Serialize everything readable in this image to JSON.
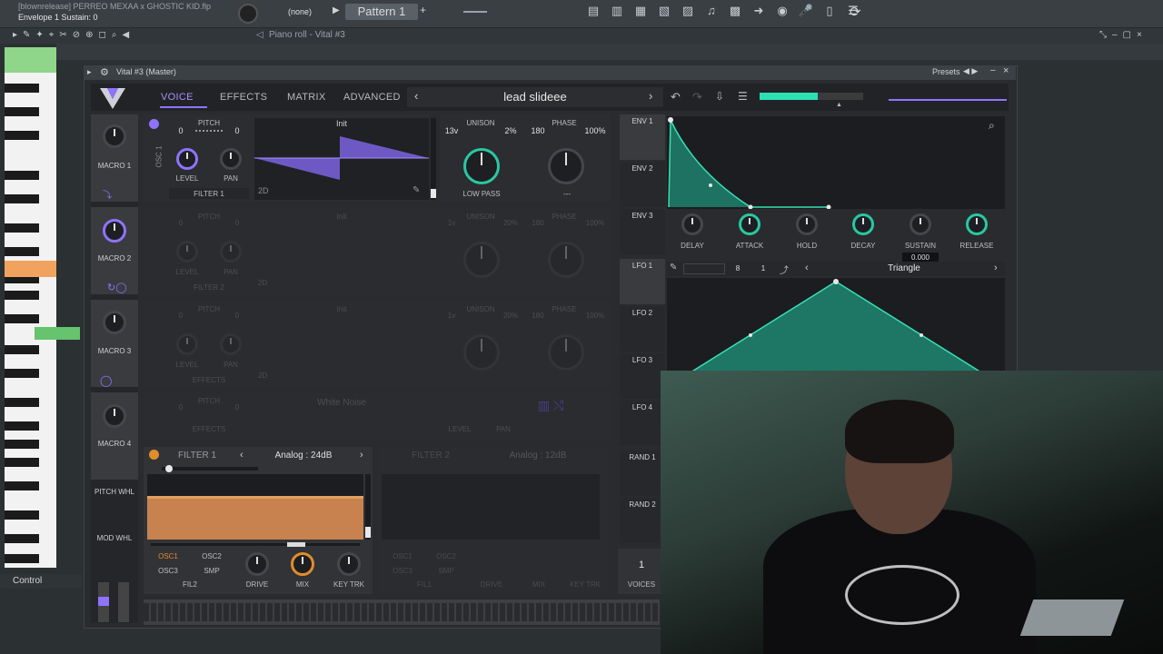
{
  "fl": {
    "file_title": "[blownrelease] PERREO MEXAA x GHOSTIC KID.flp",
    "hint": "Envelope 1 Sustain: 0",
    "pattern_label": "Pattern 1",
    "channel_selector": "(none)",
    "piano_roll_title": "Piano roll - Vital #3",
    "control_label": "Control"
  },
  "vital": {
    "window_title": "Vital #3 (Master)",
    "presets_label": "Presets",
    "tabs": [
      "VOICE",
      "EFFECTS",
      "MATRIX",
      "ADVANCED"
    ],
    "preset_name": "lead slideee",
    "macros": [
      "MACRO 1",
      "MACRO 2",
      "MACRO 3",
      "MACRO 4"
    ],
    "pitch_wheel": "PITCH WHL",
    "mod_wheel": "MOD WHL",
    "osc1": {
      "label": "OSC 1",
      "pitch_label": "PITCH",
      "pitch_left": "0",
      "pitch_right": "0",
      "wavetable": "Init",
      "level_label": "LEVEL",
      "pan_label": "PAN",
      "filter_label": "FILTER 1",
      "mode": "2D",
      "unison_label": "UNISON",
      "unison_voices": "13v",
      "unison_detune": "2%",
      "phase_label": "PHASE",
      "phase_value": "180",
      "phase_rand": "100%",
      "filter_type": "LOW PASS",
      "spectral": "---"
    },
    "osc2": {
      "pitch_label": "PITCH",
      "pitch_left": "0",
      "pitch_right": "0",
      "wavetable": "Init",
      "unison_voices": "1v",
      "unison_label": "UNISON",
      "unison_detune": "20%",
      "phase_label": "PHASE",
      "phase_value": "180",
      "phase_rand": "100%",
      "filter_label": "FILTER 2",
      "mode": "2D",
      "level_label": "LEVEL",
      "pan_label": "PAN"
    },
    "osc3": {
      "pitch_label": "PITCH",
      "pitch_left": "0",
      "pitch_right": "0",
      "wavetable": "Init",
      "unison_voices": "1v",
      "unison_label": "UNISON",
      "unison_detune": "20%",
      "phase_label": "PHASE",
      "phase_value": "180",
      "phase_rand": "100%",
      "filter_label": "EFFECTS",
      "mode": "2D",
      "level_label": "LEVEL",
      "pan_label": "PAN"
    },
    "sample": {
      "pitch_label": "PITCH",
      "pitch_left": "0",
      "pitch_right": "0",
      "name": "White Noise",
      "filter_label": "EFFECTS",
      "level_label": "LEVEL",
      "pan_label": "PAN"
    },
    "filter1": {
      "label": "FILTER 1",
      "model": "Analog : 24dB",
      "sources": [
        "OSC1",
        "OSC2",
        "OSC3",
        "SMP",
        "FIL2"
      ],
      "knobs": [
        "DRIVE",
        "MIX",
        "KEY TRK"
      ]
    },
    "filter2": {
      "label": "FILTER 2",
      "model": "Analog : 12dB",
      "sources": [
        "OSC1",
        "OSC2",
        "OSC3",
        "SMP",
        "FIL1"
      ],
      "knobs": [
        "DRIVE",
        "MIX",
        "KEY TRK"
      ]
    },
    "voices": {
      "value": "1",
      "label": "VOICES"
    },
    "env_tabs": [
      "ENV 1",
      "ENV 2",
      "ENV 3"
    ],
    "env_knobs": [
      "DELAY",
      "ATTACK",
      "HOLD",
      "DECAY",
      "SUSTAIN",
      "RELEASE"
    ],
    "sustain_readout": "0.000",
    "lfo_tabs": [
      "LFO 1",
      "LFO 2",
      "LFO 3",
      "LFO 4"
    ],
    "lfo_shape": "Triangle",
    "lfo_freq_num": "8",
    "lfo_freq_den": "1",
    "rand_tabs": [
      "RAND 1",
      "RAND 2"
    ]
  },
  "colors": {
    "accent": "#8f73ff",
    "teal": "#29c8a3",
    "filter": "#c7824f"
  }
}
